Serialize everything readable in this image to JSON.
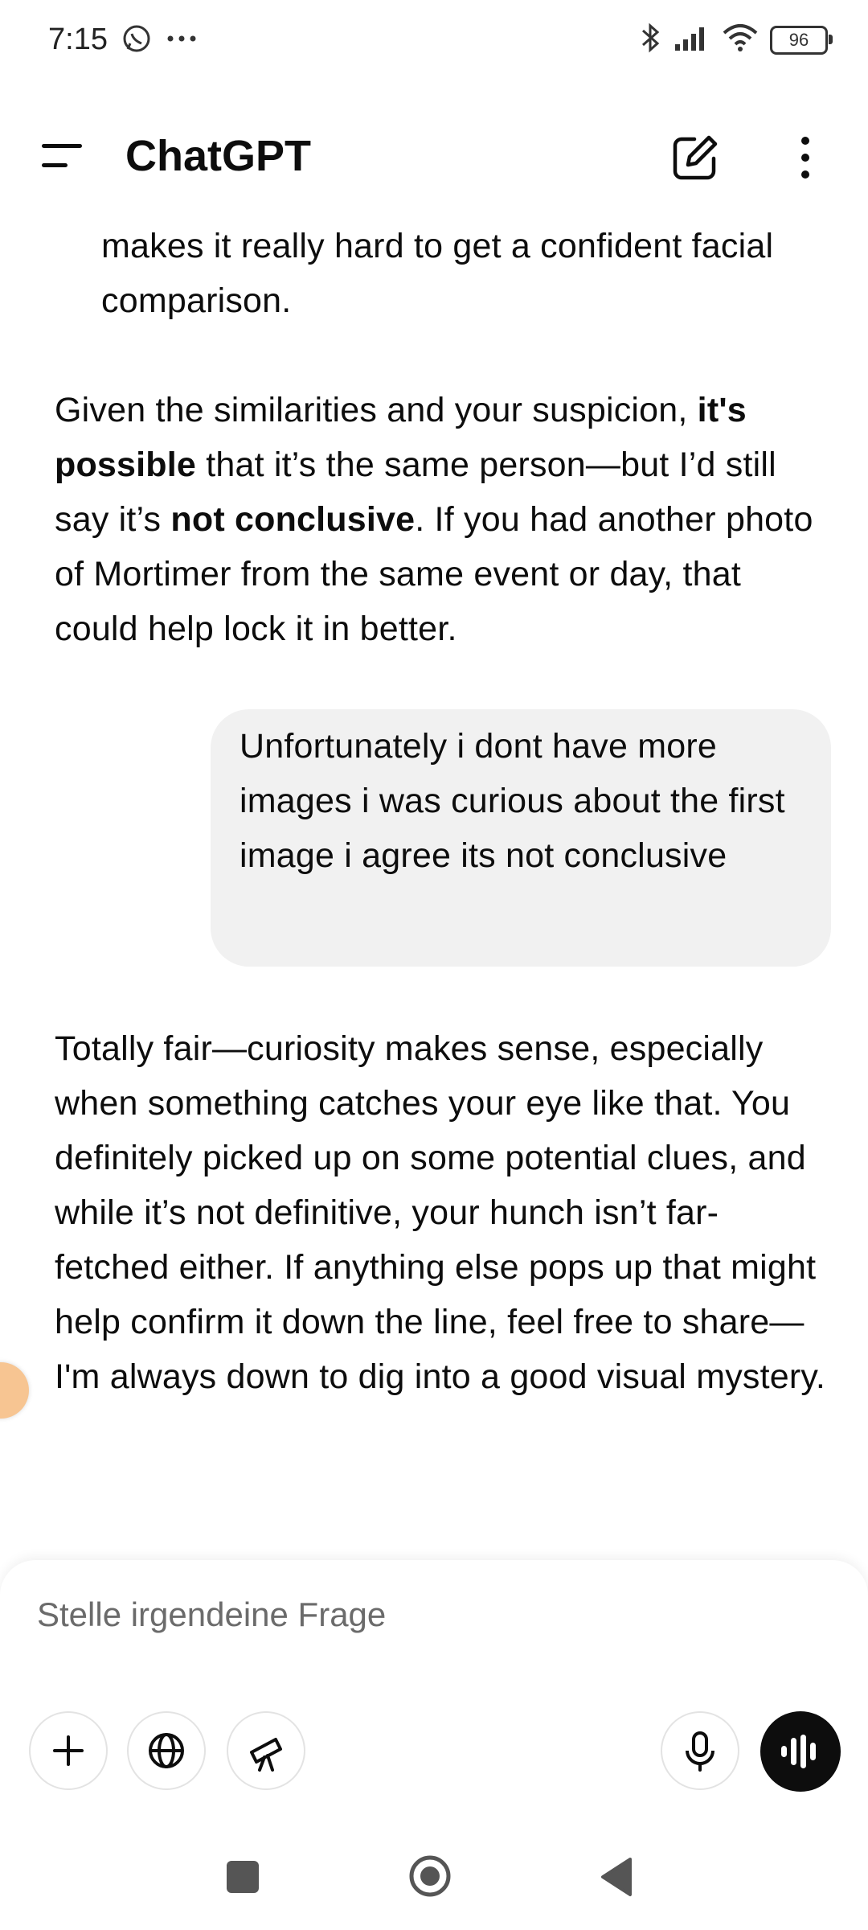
{
  "status_bar": {
    "time": "7:15",
    "left_icons": [
      "whatsapp-icon",
      "more-dots-icon"
    ],
    "right_icons": [
      "bluetooth-icon",
      "signal-icon",
      "wifi-icon"
    ],
    "battery": "96"
  },
  "header": {
    "title": "ChatGPT",
    "icons": [
      "menu-icon",
      "new-chat-edit-icon",
      "more-vertical-icon"
    ]
  },
  "messages": [
    {
      "role": "assistant",
      "segments": [
        {
          "text": "makes it really hard to get a confident facial comparison.",
          "bold": false
        }
      ]
    },
    {
      "role": "assistant",
      "segments": [
        {
          "text": "Given the similarities and your suspicion, ",
          "bold": false
        },
        {
          "text": "it's possible",
          "bold": true
        },
        {
          "text": " that it’s the same person—but I’d still say it’s ",
          "bold": false
        },
        {
          "text": "not conclusive",
          "bold": true
        },
        {
          "text": ". If you had another photo of Mortimer from the same event or day, that could help lock it in better.",
          "bold": false
        }
      ]
    },
    {
      "role": "user",
      "text": "Unfortunately i dont have more images i was curious about the first image i agree its not conclusive"
    },
    {
      "role": "assistant",
      "text": "Totally fair—curiosity makes sense, especially when something catches your eye like that. You definitely picked up on some potential clues, and while it’s not definitive, your hunch isn’t far-fetched either. If anything else pops up that might help confirm it down the line, feel free to share—I'm always down to dig into a good visual mystery."
    }
  ],
  "composer": {
    "placeholder": "Stelle irgendeine Frage",
    "buttons": [
      "plus-icon",
      "globe-icon",
      "telescope-icon",
      "microphone-icon",
      "voice-mode-icon"
    ]
  },
  "nav_bar": {
    "buttons": [
      "recents-square-icon",
      "home-circle-icon",
      "back-triangle-icon"
    ]
  },
  "colors": {
    "user_bubble": "#f1f1f1",
    "voice_button": "#0d0d0d",
    "side_tab": "#f7c592"
  }
}
